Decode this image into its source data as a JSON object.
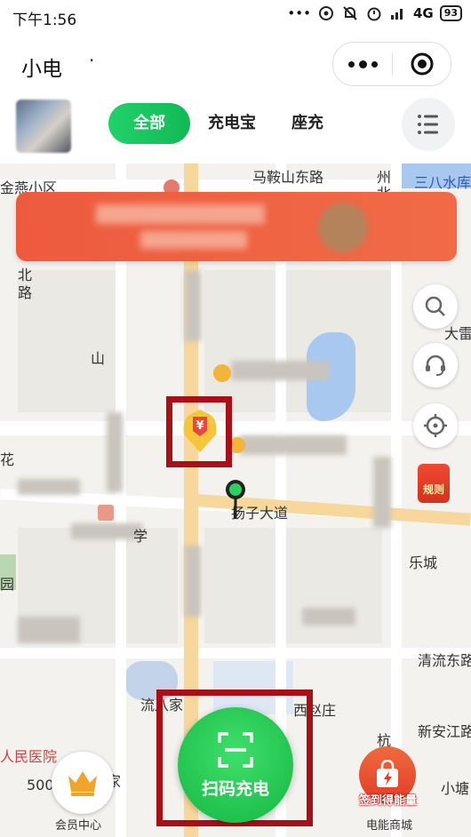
{
  "status_bar": {
    "time": "下午1:56",
    "network": "4G",
    "battery": "93"
  },
  "title_bar": {
    "title": "小电",
    "title_suffix": "·"
  },
  "tabs": [
    {
      "label": "全部",
      "active": true
    },
    {
      "label": "充电宝",
      "active": false
    },
    {
      "label": "座充",
      "active": false
    }
  ],
  "map": {
    "labels": {
      "jinyan": "金燕小区",
      "maanshan": "马鞍山东路",
      "sanba": "三八水库",
      "zhou": "州",
      "bei": "北",
      "bei2": "北",
      "lu": "路",
      "shan": "山",
      "dalei": "大雷",
      "yangzi": "扬子大道",
      "xiaoqiu": "西赵庄",
      "liujia": "流八家",
      "xinanjiang": "新安江路",
      "qingliu": "清流东路",
      "renmin": "人民医院",
      "xiaotang": "小塘",
      "hang": "杭",
      "yuan": "园",
      "hua": "花",
      "dao": "道",
      "num500": "500",
      "jia": "家",
      "xue": "学",
      "le": "乐城"
    }
  },
  "side_buttons": [
    "search-icon",
    "customer-service-icon",
    "locate-icon"
  ],
  "rules_badge": "规则",
  "bottom": {
    "member_label": "会员中心",
    "scan_label": "扫码充电",
    "mall_label": "电能商城",
    "mall_sub": "签到得能量"
  },
  "colors": {
    "accent": "#18c454",
    "banner": "#ee5a3e",
    "highlight_box": "#a90f17"
  }
}
